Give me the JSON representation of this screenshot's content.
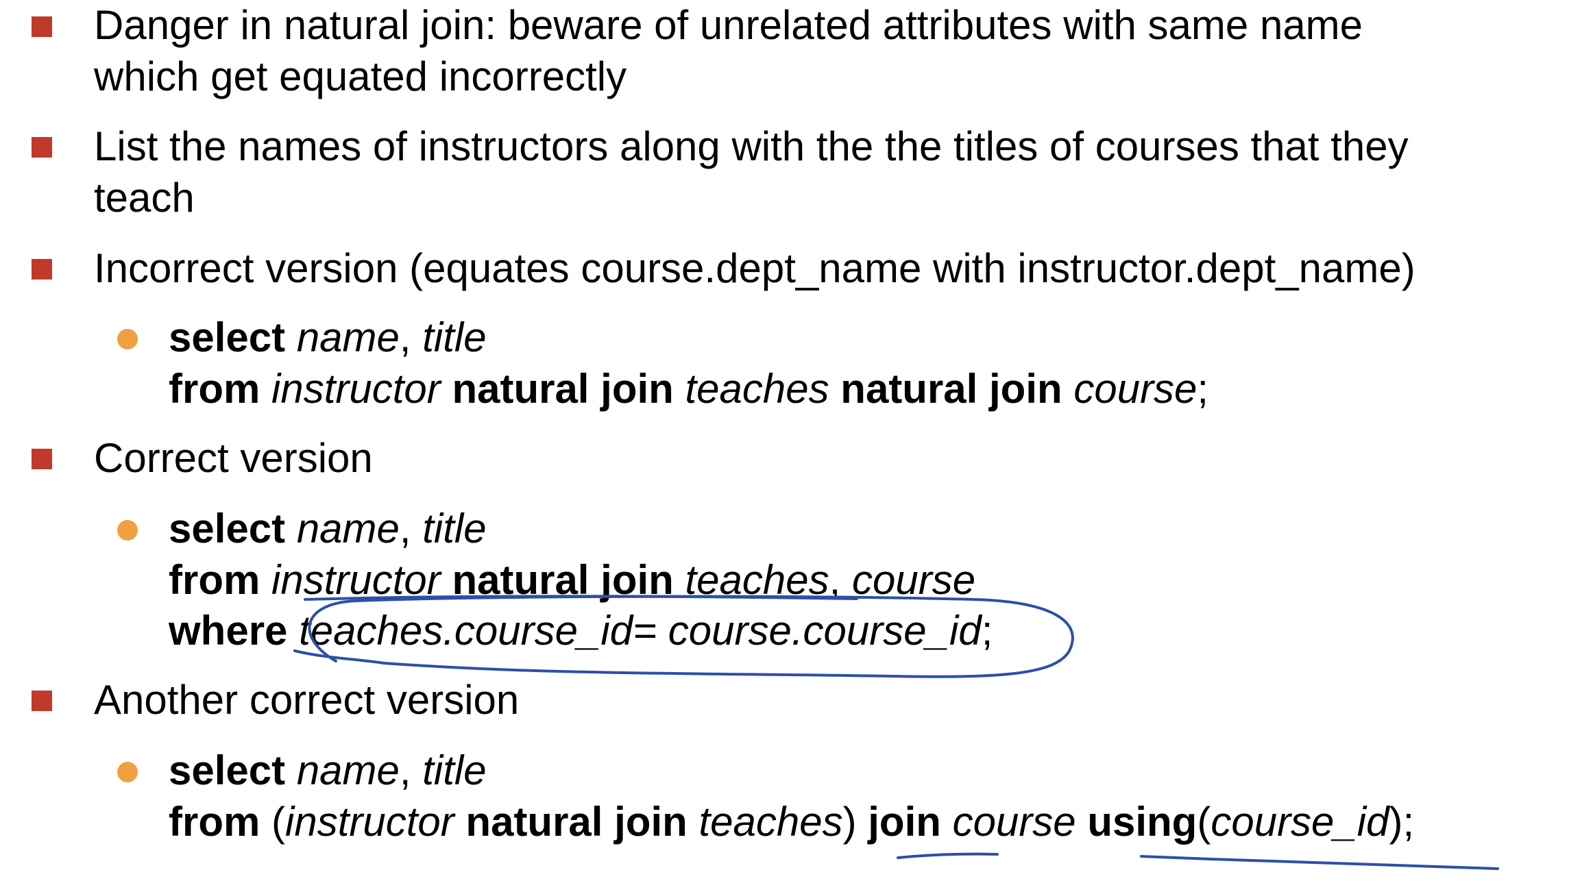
{
  "slide": {
    "items": [
      {
        "lines": [
          "Danger in natural join: beware of unrelated attributes with same name",
          "which get equated incorrectly"
        ]
      },
      {
        "lines": [
          "List the names of instructors along with the the titles of courses that they",
          "teach"
        ]
      },
      {
        "lines": [
          "Incorrect version (equates course.dept_name with instructor.dept_name)"
        ],
        "sql": {
          "select_kw": "select",
          "select_cols": "name",
          "comma": ",",
          "select_col2": "title",
          "from_kw": "from",
          "from_t1": "instructor",
          "nj1": "natural join",
          "from_t2": "teaches",
          "nj2": "natural join",
          "from_t3": "course",
          "end": ";"
        }
      },
      {
        "lines": [
          "Correct version"
        ],
        "sql": {
          "select_kw": "select",
          "select_cols": "name",
          "comma": ",",
          "select_col2": "title",
          "from_kw": "from",
          "from_t1": "instructor",
          "nj1": "natural join",
          "from_t2": "teaches",
          "comma2": ",",
          "from_t3": "course",
          "where_kw": "where",
          "where_cond": "teaches.course_id= course.course_id",
          "end": ";"
        }
      },
      {
        "lines": [
          "Another correct version"
        ],
        "sql": {
          "select_kw": "select",
          "select_cols": "name",
          "comma": ",",
          "select_col2": "title",
          "from_kw": "from",
          "paren_open": "(",
          "from_t1": "instructor",
          "nj1": "natural join",
          "from_t2": "teaches",
          "paren_close": ")",
          "join_kw": "join",
          "from_t3": "course",
          "using_kw": "using",
          "using_open": "(",
          "using_col": "course_id",
          "using_close": ");"
        }
      }
    ],
    "colors": {
      "square_bullet": "#c0392b",
      "round_bullet": "#f0a040",
      "ink": "#2c4fa8"
    }
  }
}
